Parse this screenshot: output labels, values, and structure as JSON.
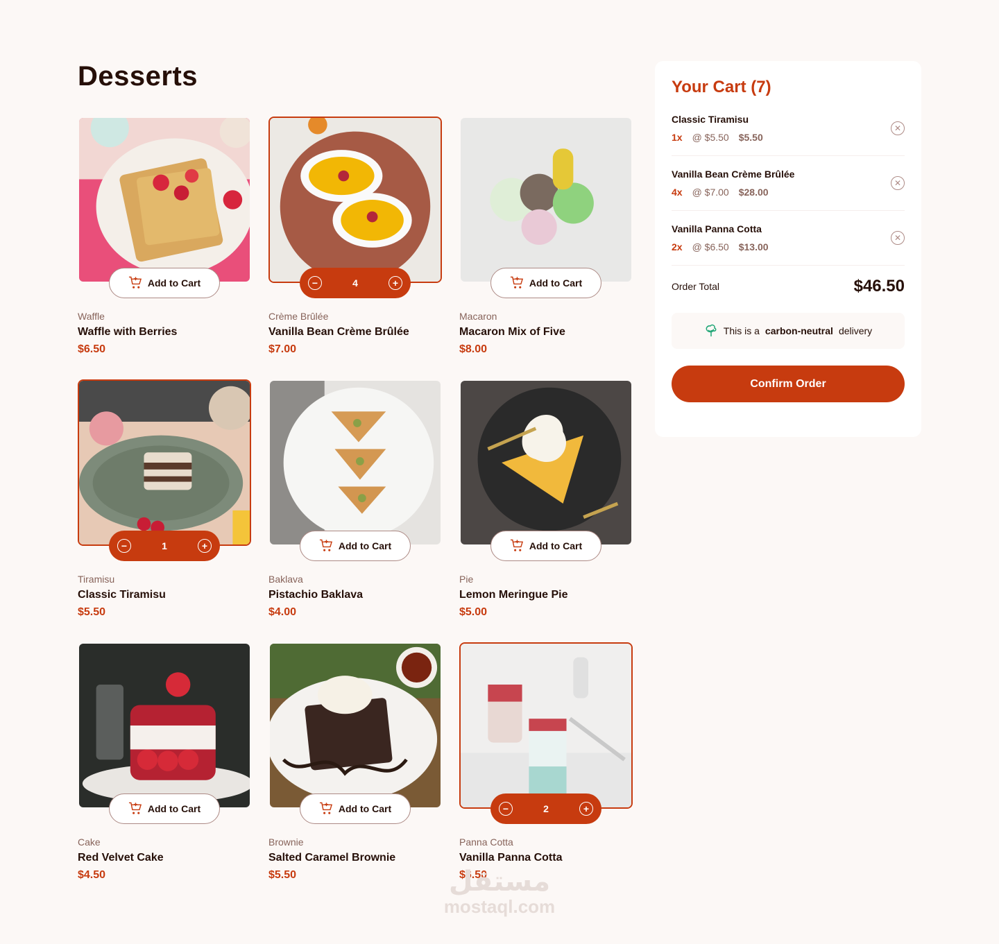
{
  "page": {
    "title": "Desserts"
  },
  "colors": {
    "accent": "#c73b0f",
    "text": "#260f08",
    "muted": "#87635a",
    "bg": "#fcf8f6"
  },
  "products": [
    {
      "category": "Waffle",
      "name": "Waffle with Berries",
      "price": "$6.50",
      "in_cart": false,
      "quantity": "",
      "add_label": "Add to Cart",
      "image": "waffle-photo"
    },
    {
      "category": "Crème Brûlée",
      "name": "Vanilla Bean Crème Brûlée",
      "price": "$7.00",
      "in_cart": true,
      "quantity": "4",
      "add_label": "Add to Cart",
      "image": "creme-brulee-photo"
    },
    {
      "category": "Macaron",
      "name": "Macaron Mix of Five",
      "price": "$8.00",
      "in_cart": false,
      "quantity": "",
      "add_label": "Add to Cart",
      "image": "macaron-photo"
    },
    {
      "category": "Tiramisu",
      "name": "Classic Tiramisu",
      "price": "$5.50",
      "in_cart": true,
      "quantity": "1",
      "add_label": "Add to Cart",
      "image": "tiramisu-photo"
    },
    {
      "category": "Baklava",
      "name": "Pistachio Baklava",
      "price": "$4.00",
      "in_cart": false,
      "quantity": "",
      "add_label": "Add to Cart",
      "image": "baklava-photo"
    },
    {
      "category": "Pie",
      "name": "Lemon Meringue Pie",
      "price": "$5.00",
      "in_cart": false,
      "quantity": "",
      "add_label": "Add to Cart",
      "image": "pie-photo"
    },
    {
      "category": "Cake",
      "name": "Red Velvet Cake",
      "price": "$4.50",
      "in_cart": false,
      "quantity": "",
      "add_label": "Add to Cart",
      "image": "cake-photo"
    },
    {
      "category": "Brownie",
      "name": "Salted Caramel Brownie",
      "price": "$5.50",
      "in_cart": false,
      "quantity": "",
      "add_label": "Add to Cart",
      "image": "brownie-photo"
    },
    {
      "category": "Panna Cotta",
      "name": "Vanilla Panna Cotta",
      "price": "$6.50",
      "in_cart": true,
      "quantity": "2",
      "add_label": "Add to Cart",
      "image": "panna-cotta-photo"
    }
  ],
  "cart": {
    "title": "Your Cart (7)",
    "items": [
      {
        "name": "Classic Tiramisu",
        "qty": "1x",
        "unit": "@ $5.50",
        "total": "$5.50"
      },
      {
        "name": "Vanilla Bean Crème Brûlée",
        "qty": "4x",
        "unit": "@ $7.00",
        "total": "$28.00"
      },
      {
        "name": "Vanilla Panna Cotta",
        "qty": "2x",
        "unit": "@ $6.50",
        "total": "$13.00"
      }
    ],
    "order_total_label": "Order Total",
    "order_total_value": "$46.50",
    "carbon_prefix": "This is a",
    "carbon_bold": "carbon-neutral",
    "carbon_suffix": "delivery",
    "confirm_label": "Confirm Order"
  },
  "watermark": {
    "arabic": "مستقل",
    "latin": "mostaql.com"
  }
}
